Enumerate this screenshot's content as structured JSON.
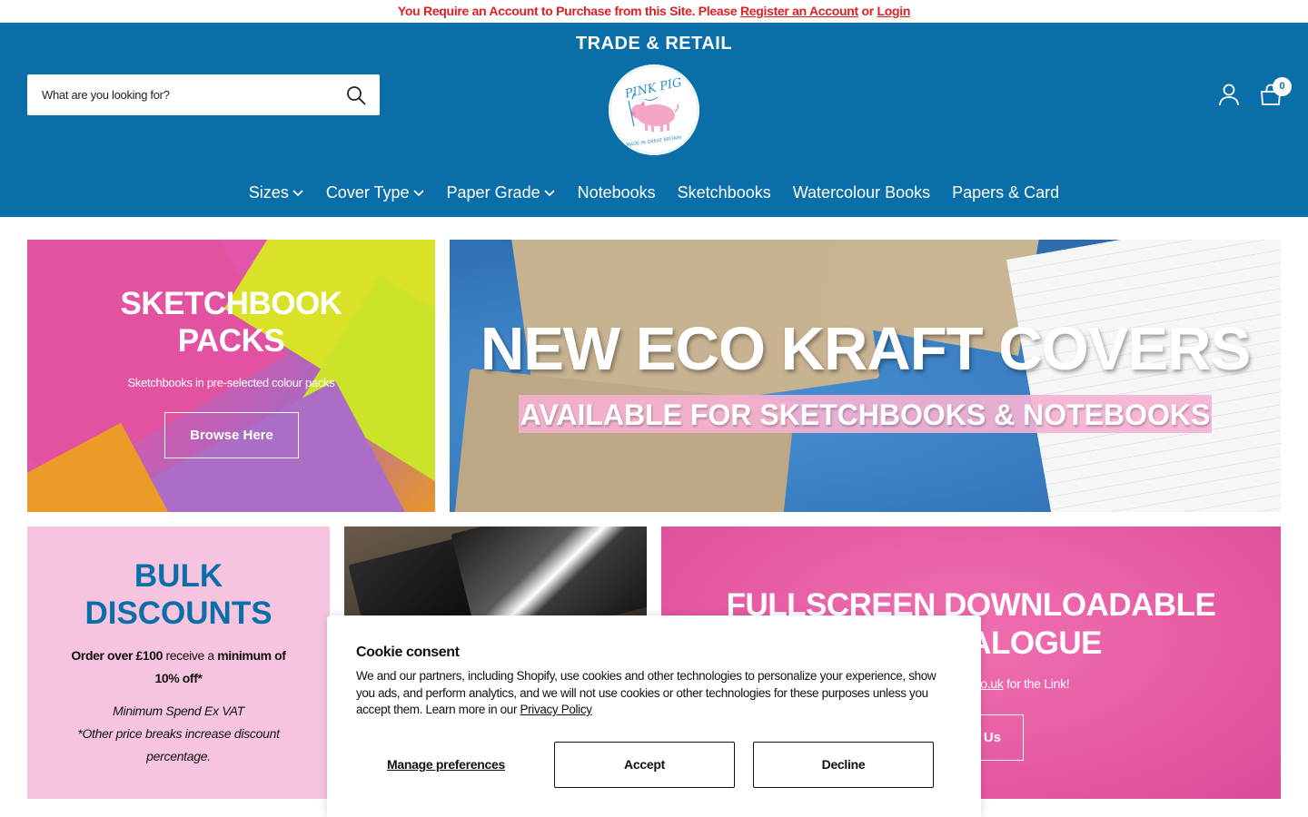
{
  "announcement": {
    "prefix": "You Require an Account to Purchase from this Site. Please ",
    "register_link": "Register an Account",
    "middle": " or ",
    "login_link": "Login"
  },
  "header": {
    "tagline": "TRADE & RETAIL",
    "search_placeholder": "What are you looking for?",
    "cart_count": "0",
    "logo_text": "PINK PIG",
    "logo_subtext": "MADE IN GREAT BRITAIN"
  },
  "nav": {
    "items": [
      {
        "label": "Sizes",
        "has_dropdown": true
      },
      {
        "label": "Cover Type",
        "has_dropdown": true
      },
      {
        "label": "Paper Grade",
        "has_dropdown": true
      },
      {
        "label": "Notebooks",
        "has_dropdown": false
      },
      {
        "label": "Sketchbooks",
        "has_dropdown": false
      },
      {
        "label": "Watercolour Books",
        "has_dropdown": false
      },
      {
        "label": "Papers & Card",
        "has_dropdown": false
      }
    ]
  },
  "tiles": {
    "packs": {
      "title_line1": "SKETCHBOOK",
      "title_line2": "PACKS",
      "subtitle": "Sketchbooks in pre-selected colour packs",
      "button": "Browse Here"
    },
    "eco": {
      "title": "NEW ECO KRAFT COVERS",
      "subtitle": "AVAILABLE FOR SKETCHBOOKS & NOTEBOOKS"
    },
    "bulk": {
      "title_line1": "BULK",
      "title_line2": "DISCOUNTS",
      "order_bold1": "Order over £100",
      "order_text": " receive a ",
      "order_bold2": "minimum of 10% off*",
      "note_line1": "Minimum Spend Ex VAT",
      "note_line2": "*Other price breaks increase discount percentage."
    },
    "catalogue": {
      "title_line1": "FULLSCREEN DOWNLOADABLE",
      "title_line2": "TALOGUE",
      "text_link": "-pink-pig.co.uk",
      "text_suffix": " for the Link!",
      "button": "Us"
    }
  },
  "cookie": {
    "title": "Cookie consent",
    "text": "We and our partners, including Shopify, use cookies and other technologies to personalize your experience, show you ads, and perform analytics, and we will not use cookies or other technologies for these purposes unless you accept them. Learn more in our ",
    "privacy_link": "Privacy Policy",
    "manage": "Manage preferences",
    "accept": "Accept",
    "decline": "Decline"
  },
  "colors": {
    "brand_blue": "#0a6ea8",
    "alert_red": "#e02020",
    "bulk_pink": "#f7c4df",
    "catalogue_pink": "#e65aa3"
  }
}
